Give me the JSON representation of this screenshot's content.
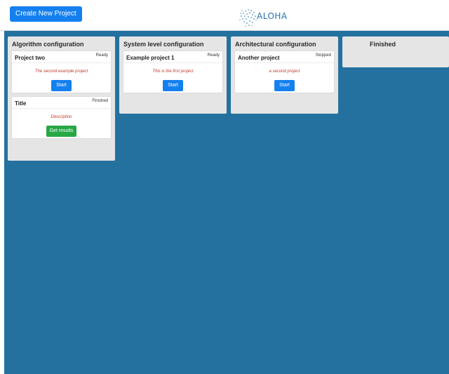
{
  "header": {
    "create_button_label": "Create New Project",
    "logo_text": "ALOHA"
  },
  "colors": {
    "board_background": "#24719f",
    "primary_button": "#1480f0",
    "success_button": "#28a745",
    "description_text": "#c0392b"
  },
  "columns": [
    {
      "title": "Algorithm configuration",
      "cards": [
        {
          "title": "Project two",
          "status": "Ready",
          "description": "The second example project",
          "action": "Start"
        },
        {
          "title": "Title",
          "status": "Finished",
          "description": "Description",
          "action": "Get results"
        }
      ]
    },
    {
      "title": "System level configuration",
      "cards": [
        {
          "title": "Example project 1",
          "status": "Ready",
          "description": "This is the first project",
          "action": "Start"
        }
      ]
    },
    {
      "title": "Architectural configuration",
      "cards": [
        {
          "title": "Another project",
          "status": "Stopped",
          "description": "a second project",
          "action": "Start"
        }
      ]
    },
    {
      "title": "Finished",
      "cards": []
    }
  ]
}
